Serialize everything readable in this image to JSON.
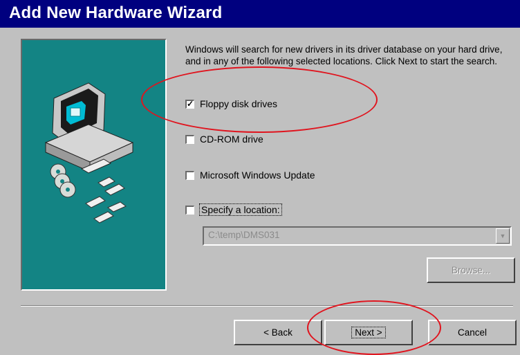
{
  "window": {
    "title": "Add New Hardware Wizard"
  },
  "intro_text": "Windows will search for new drivers in its driver database on your hard drive, and in any of the following selected locations. Click Next to start the search.",
  "options": [
    {
      "label": "Floppy disk drives",
      "checked": true
    },
    {
      "label": "CD-ROM drive",
      "checked": false
    },
    {
      "label": "Microsoft Windows Update",
      "checked": false
    },
    {
      "label": "Specify a location:",
      "checked": false
    }
  ],
  "location": {
    "value": "C:\\temp\\DMS031"
  },
  "buttons": {
    "browse": "Browse...",
    "back": "< Back",
    "next": "Next >",
    "cancel": "Cancel"
  },
  "colors": {
    "title_bar": "#00007f",
    "panel": "#138484",
    "annotation": "#e0141e"
  }
}
